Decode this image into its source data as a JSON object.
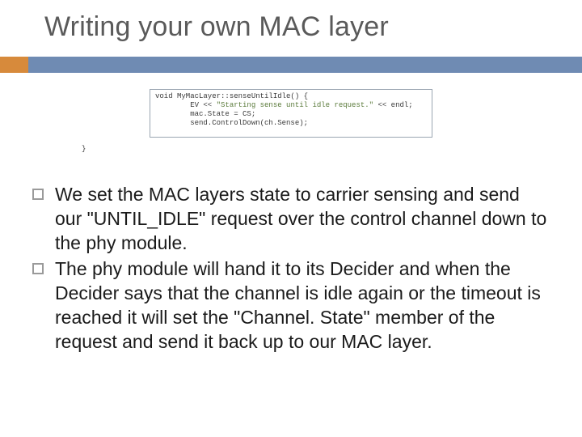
{
  "title": "Writing your own MAC layer",
  "code": {
    "line1_pre": "void MyMacLayer::senseUntilIdle() {",
    "line2_indent": "        EV << ",
    "line2_str": "\"Starting sense until idle request.\"",
    "line2_post": " << endl;",
    "line3": "        mac.State = CS;",
    "line4": "",
    "line5": "        send.ControlDown(ch.Sense);"
  },
  "stray": "}",
  "bullets": [
    "We set the MAC layers state to carrier sensing and send our \"UNTIL_IDLE\" request over the control channel down to the phy module.",
    "The phy module will hand it to its Decider and when the Decider says that the channel is idle again or the timeout is reached it will set the \"Channel. State\" member of the request and send it back up to our MAC layer."
  ]
}
